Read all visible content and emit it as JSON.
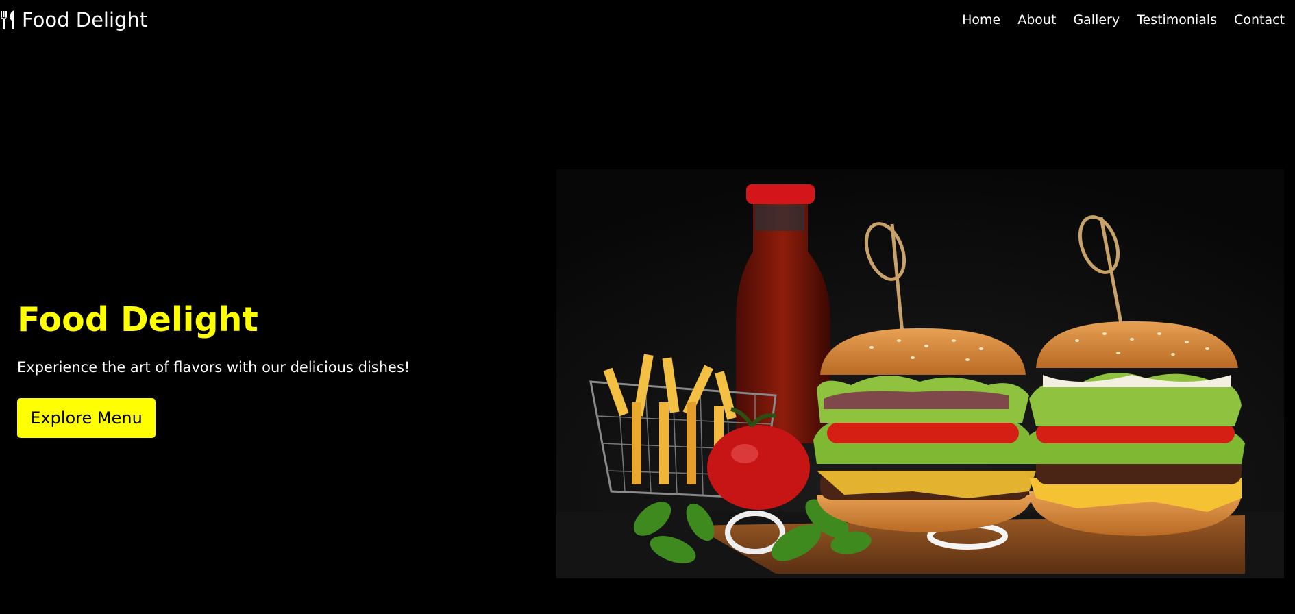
{
  "brand": {
    "name": "Food Delight",
    "icon": "utensils-icon"
  },
  "nav": {
    "items": [
      {
        "label": "Home"
      },
      {
        "label": "About"
      },
      {
        "label": "Gallery"
      },
      {
        "label": "Testimonials"
      },
      {
        "label": "Contact"
      }
    ]
  },
  "hero": {
    "title": "Food Delight",
    "subtitle": "Experience the art of flavors with our delicious dishes!",
    "button_label": "Explore Menu",
    "image_alt": "Burgers with fries and ketchup"
  },
  "colors": {
    "accent": "#ffff00",
    "background": "#000000",
    "text": "#ffffff"
  }
}
